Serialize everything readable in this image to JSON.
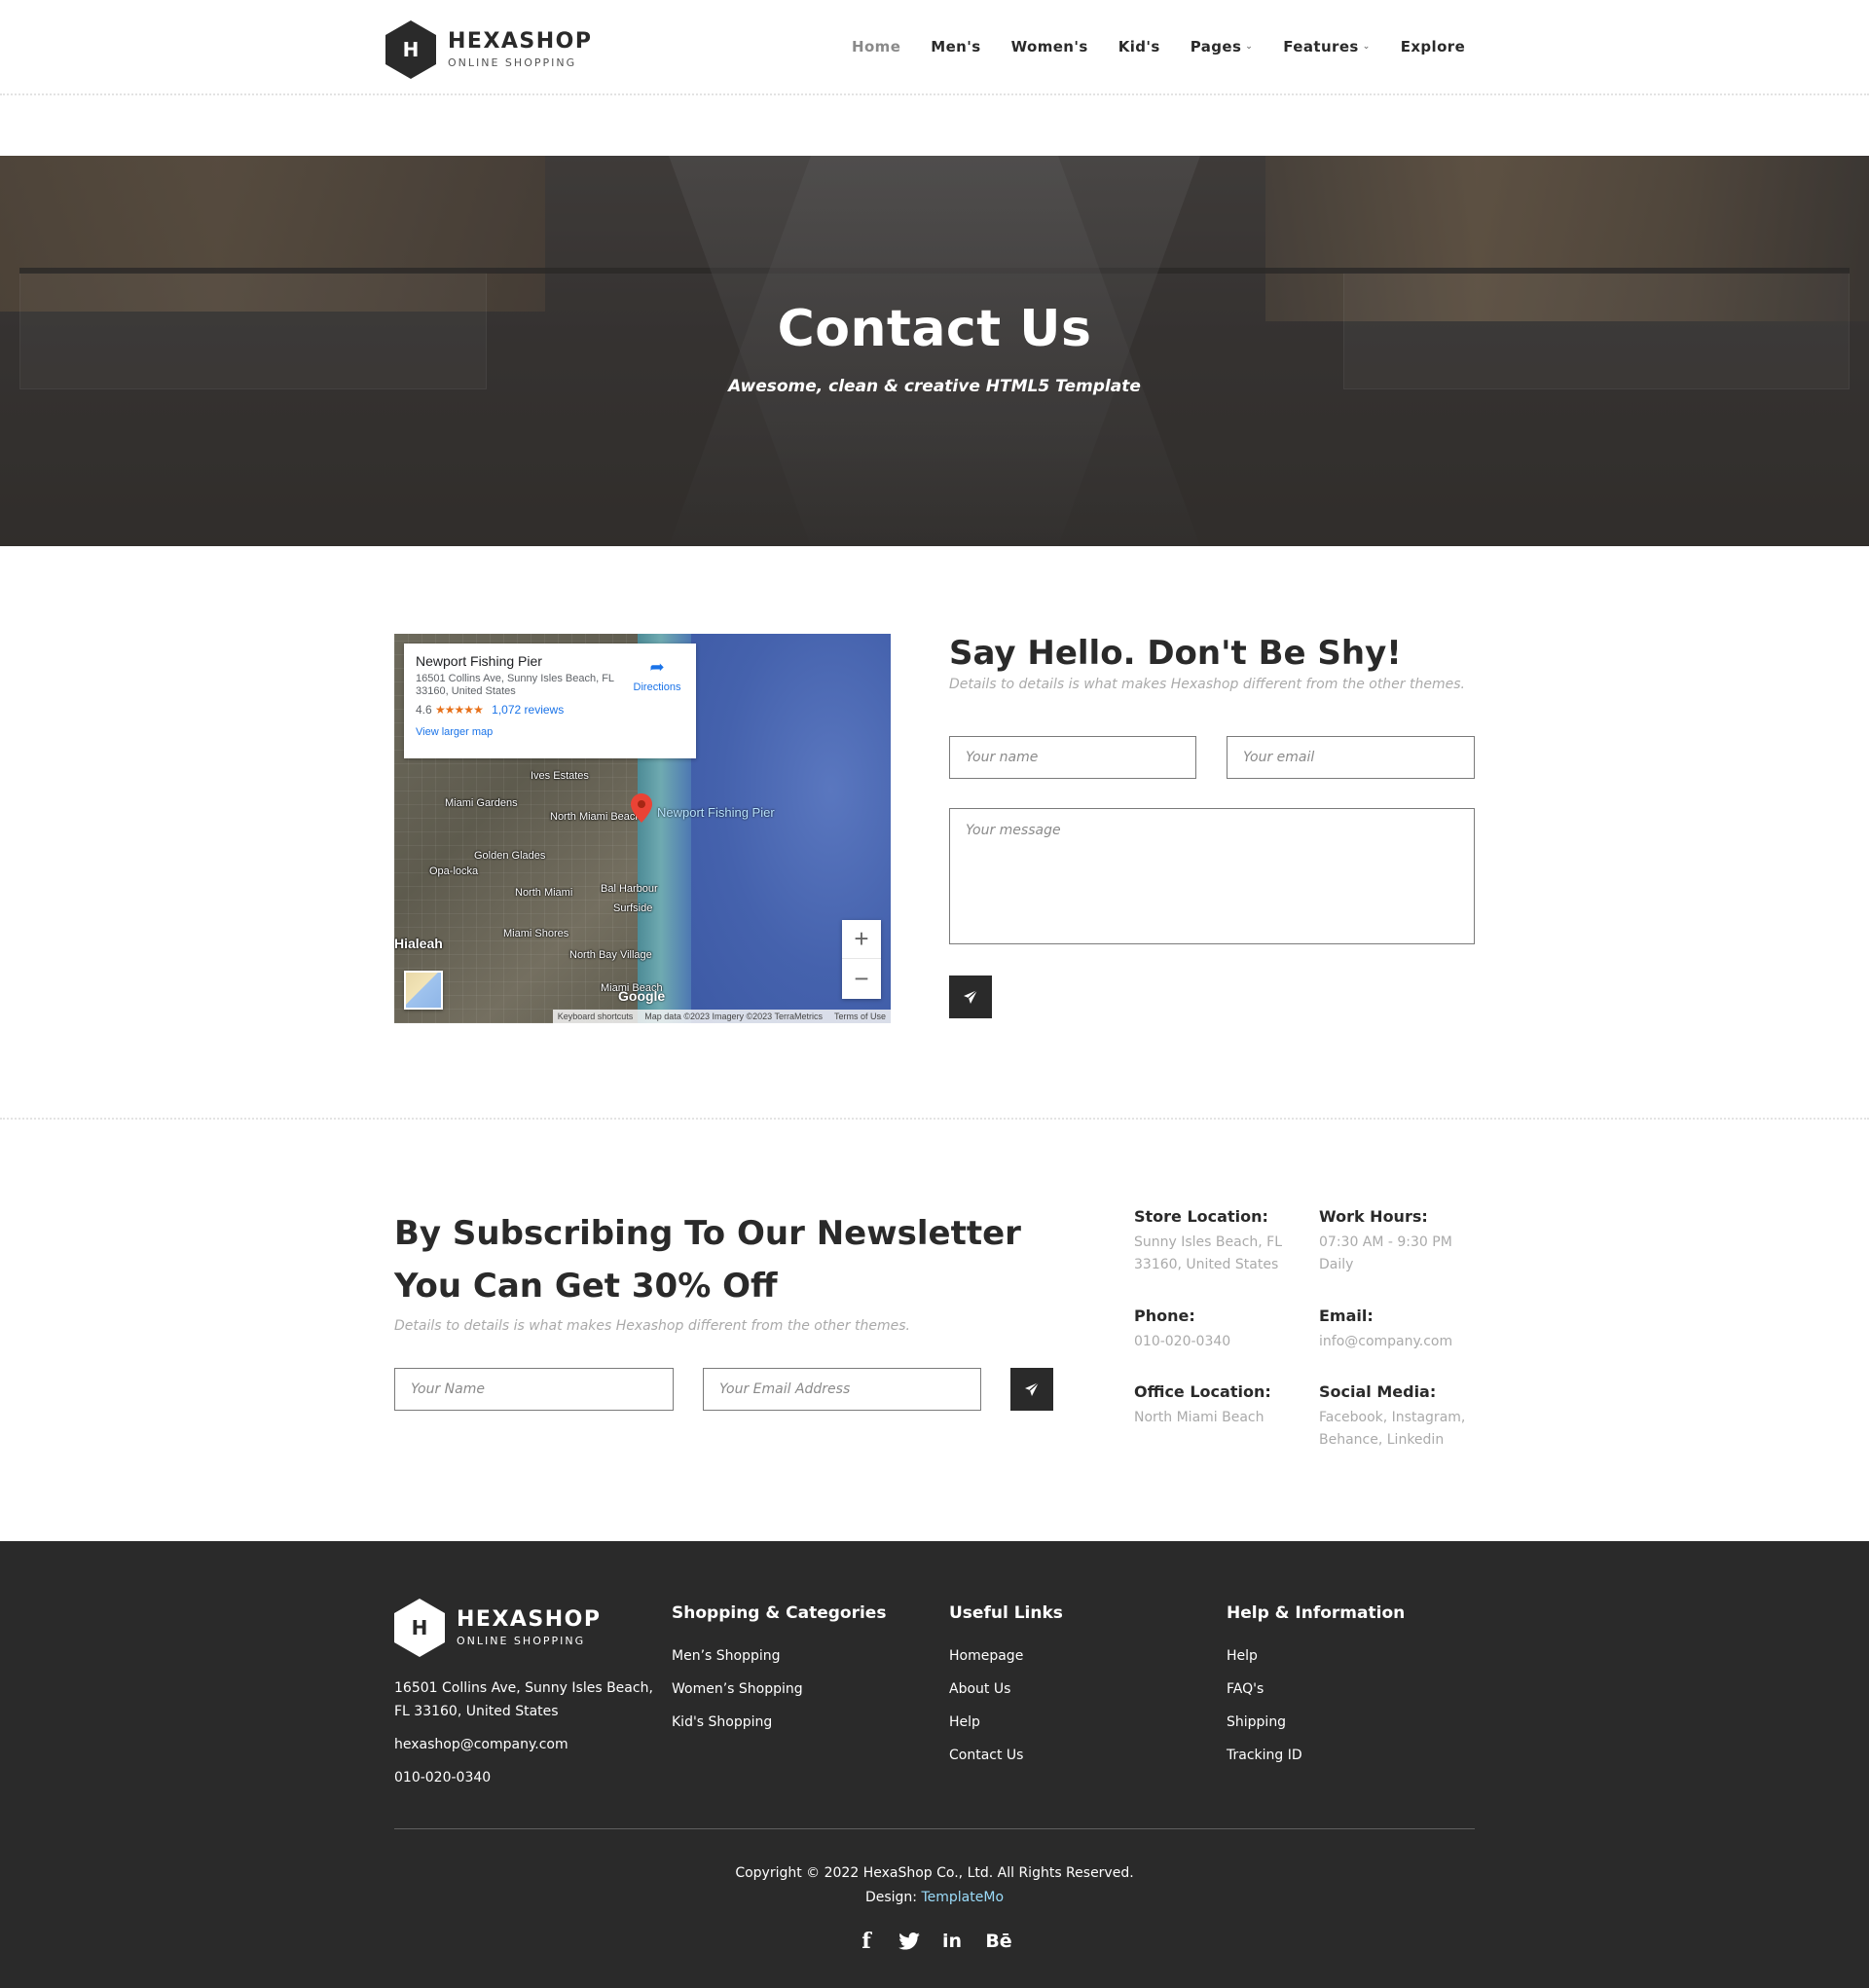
{
  "brand": {
    "name": "HEXASHOP",
    "tagline": "ONLINE SHOPPING",
    "mark": "H"
  },
  "nav": {
    "items": [
      {
        "label": "Home",
        "active": true
      },
      {
        "label": "Men's"
      },
      {
        "label": "Women's"
      },
      {
        "label": "Kid's"
      },
      {
        "label": "Pages",
        "dropdown": true
      },
      {
        "label": "Features",
        "dropdown": true
      },
      {
        "label": "Explore"
      }
    ]
  },
  "hero": {
    "title": "Contact Us",
    "subtitle": "Awesome, clean & creative HTML5 Template"
  },
  "map": {
    "place_name": "Newport Fishing Pier",
    "place_address": "16501 Collins Ave, Sunny Isles Beach, FL 33160, United States",
    "rating": "4.6",
    "stars": "★★★★★",
    "reviews": "1,072 reviews",
    "directions": "Directions",
    "larger_map": "View larger map",
    "pin_label": "Newport Fishing Pier",
    "towns": [
      "Ives Estates",
      "Miami Gardens",
      "North Miami Beach",
      "Golden Glades",
      "Opa-locka",
      "North Miami",
      "Bal Harbour",
      "Surfside",
      "Miami Shores",
      "Hialeah",
      "North Bay Village",
      "Miami Beach"
    ],
    "google_logo": "Google",
    "footer_shortcuts": "Keyboard shortcuts",
    "footer_mapdata": "Map data ©2023 Imagery ©2023 TerraMetrics",
    "footer_terms": "Terms of Use",
    "zoom_in": "+",
    "zoom_out": "−"
  },
  "contact": {
    "heading": "Say Hello. Don't Be Shy!",
    "description": "Details to details is what makes Hexashop different from the other themes.",
    "name_placeholder": "Your name",
    "email_placeholder": "Your email",
    "message_placeholder": "Your message"
  },
  "newsletter": {
    "heading": "By Subscribing To Our Newsletter You Can Get 30% Off",
    "description": "Details to details is what makes Hexashop different from the other themes.",
    "name_placeholder": "Your Name",
    "email_placeholder": "Your Email Address"
  },
  "info": [
    {
      "label": "Store Location:",
      "value": "Sunny Isles Beach, FL 33160, United States"
    },
    {
      "label": "Work Hours:",
      "value": "07:30 AM - 9:30 PM Daily"
    },
    {
      "label": "Phone:",
      "value": "010-020-0340"
    },
    {
      "label": "Email:",
      "value": "info@company.com"
    },
    {
      "label": "Office Location:",
      "value": "North Miami Beach"
    },
    {
      "label": "Social Media:",
      "value": "Facebook, Instagram, Behance, Linkedin"
    }
  ],
  "footer": {
    "address": "16501 Collins Ave, Sunny Isles Beach, FL 33160, United States",
    "email": "hexashop@company.com",
    "phone": "010-020-0340",
    "columns": [
      {
        "title": "Shopping & Categories",
        "links": [
          "Men’s Shopping",
          "Women’s Shopping",
          "Kid's Shopping"
        ]
      },
      {
        "title": "Useful Links",
        "links": [
          "Homepage",
          "About Us",
          "Help",
          "Contact Us"
        ]
      },
      {
        "title": "Help & Information",
        "links": [
          "Help",
          "FAQ's",
          "Shipping",
          "Tracking ID"
        ]
      }
    ],
    "copyright": "Copyright © 2022 HexaShop Co., Ltd. All Rights Reserved.",
    "design_label": "Design:",
    "design_link": "TemplateMo",
    "social_icons": [
      "facebook-icon",
      "twitter-icon",
      "linkedin-icon",
      "behance-icon"
    ],
    "social_glyphs": [
      "f",
      "🐦",
      "in",
      "Bē"
    ]
  },
  "colors": {
    "dark": "#2a2a2a",
    "muted": "#aaaaaa",
    "link_accent": "#9bdcfa"
  }
}
